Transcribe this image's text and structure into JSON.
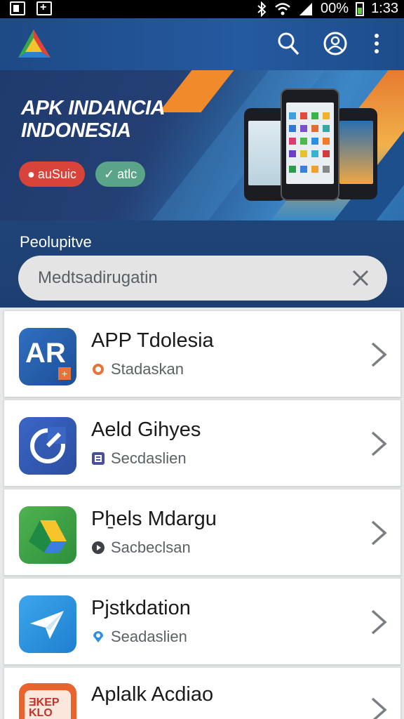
{
  "status_bar": {
    "battery_pct": "00%",
    "time": "1:33"
  },
  "banner": {
    "title_line1": "APK INDANCIA",
    "title_line2": "INDONESIA",
    "pill1": "auSuic",
    "pill2": "atlc"
  },
  "search": {
    "label": "Peolupitve",
    "value": "Medtsadirugatin"
  },
  "apps": [
    {
      "name": "APP Tdolesia",
      "sub": "Stadaskan",
      "icon_text": "AR"
    },
    {
      "name": "Aeld Gihyes",
      "sub": "Secdaslien"
    },
    {
      "name": "Pẖels Mdargu",
      "sub": "Sacbeclsan"
    },
    {
      "name": "Pjstkdation",
      "sub": "Seadaslien"
    },
    {
      "name": "Aplalk Acdiao",
      "sub": "",
      "icon_text": "ƎKEP KLO"
    }
  ],
  "colors": {
    "app_bar": "#245aa0",
    "banner_dark": "#1f3b6e",
    "pill_red": "#d9443a",
    "pill_green": "#5aa589"
  }
}
